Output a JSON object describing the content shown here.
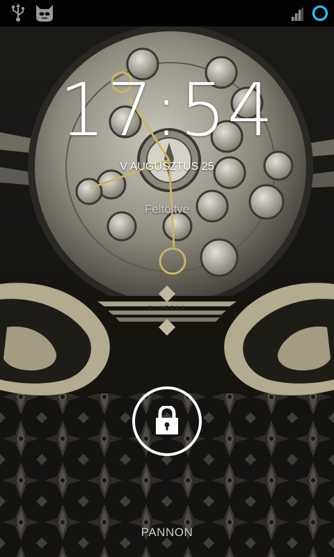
{
  "status_bar": {
    "left_icons": [
      "usb-icon",
      "cyanogenmod-icon"
    ],
    "right_icons": [
      "signal-icon",
      "sync-circle-icon"
    ],
    "accent_color": "#33b5e5"
  },
  "lockscreen": {
    "time": "17:54",
    "date": "V AUGUSZTUS 25",
    "status": "Feltöltve",
    "carrier": "PANNON",
    "unlock_icon": "padlock-icon"
  },
  "wallpaper": {
    "logo_text": "SILVERNA"
  }
}
